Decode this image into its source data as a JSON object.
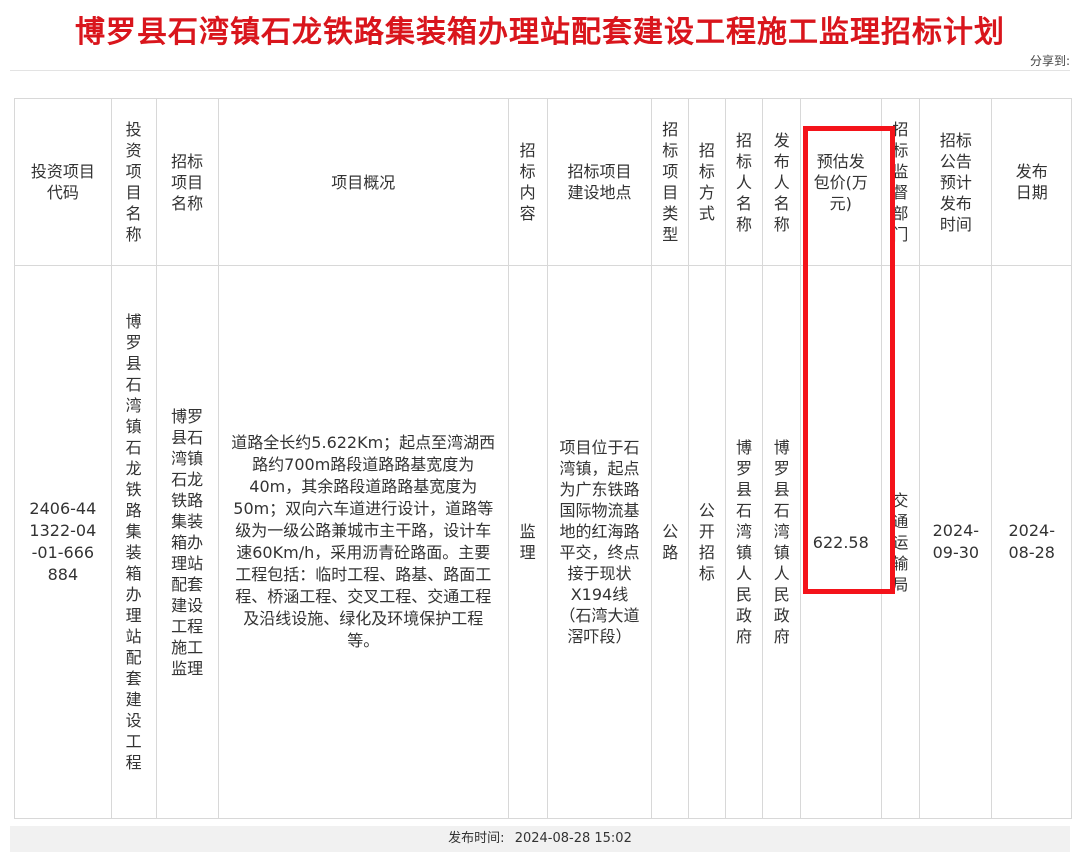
{
  "page": {
    "title": "博罗县石湾镇石龙铁路集装箱办理站配套建设工程施工监理招标计划",
    "share_label": "分享到:"
  },
  "table": {
    "headers": {
      "project_code": "投资项目代码",
      "project_name": "投资项目名称",
      "bid_name": "招标项目名称",
      "overview": "项目概况",
      "bid_content": "招标内容",
      "location": "招标项目建设地点",
      "project_type": "招标项目类型",
      "bid_method": "招标方式",
      "tenderer": "招标人名称",
      "publisher": "发布人名称",
      "price": "预估发包价(万元)",
      "supervisor": "招标监督部门",
      "notice_time": "招标公告预计发布时间",
      "publish_date": "发布日期"
    },
    "row": {
      "project_code": "2406-441322-04-01-666884",
      "project_name": "博罗县石湾镇石龙铁路集装箱办理站配套建设工程",
      "bid_name": "博罗县石湾镇石龙铁路集装箱办理站配套建设工程施工监理",
      "overview": "道路全长约5.622Km；起点至湾湖西路约700m路段道路路基宽度为40m，其余路段道路路基宽度为50m；双向六车道进行设计，道路等级为一级公路兼城市主干路，设计车速60Km/h，采用沥青砼路面。主要工程包括：临时工程、路基、路面工程、桥涵工程、交叉工程、交通工程及沿线设施、绿化及环境保护工程等。",
      "bid_content": "监理",
      "location": "项目位于石湾镇，起点为广东铁路国际物流基地的红海路平交，终点接于现状X194线（石湾大道滘吓段）",
      "project_type": "公路",
      "bid_method": "公开招标",
      "tenderer": "博罗县石湾镇人民政府",
      "publisher": "博罗县石湾镇人民政府",
      "price": "622.58",
      "supervisor": "交通运输局",
      "notice_time": "2024-09-30",
      "publish_date": "2024-08-28"
    }
  },
  "footer": {
    "label": "发布时间:",
    "value": "2024-08-28 15:02"
  },
  "colors": {
    "title": "#d9151c",
    "highlight_border": "#f4131a",
    "grid_border": "#d8d8d8",
    "footer_bg": "#f1f1f1"
  }
}
